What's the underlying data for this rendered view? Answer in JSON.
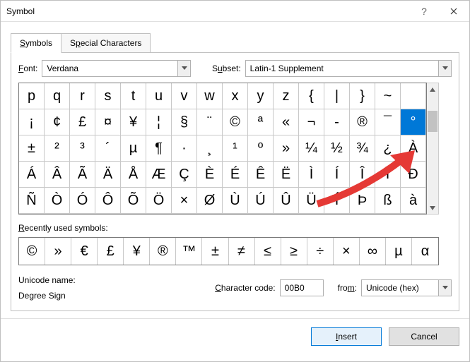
{
  "window": {
    "title": "Symbol"
  },
  "tabs": {
    "symbols": "Symbols",
    "special": "Special Characters"
  },
  "font": {
    "label": "Font:",
    "value": "Verdana"
  },
  "subset": {
    "label": "Subset:",
    "value": "Latin-1 Supplement"
  },
  "grid": [
    "p",
    "q",
    "r",
    "s",
    "t",
    "u",
    "v",
    "w",
    "x",
    "y",
    "z",
    "{",
    "|",
    "}",
    "~",
    "",
    "¡",
    "¢",
    "£",
    "¤",
    "¥",
    "¦",
    "§",
    "¨",
    "©",
    "ª",
    "«",
    "¬",
    "-",
    "®",
    "¯",
    "°",
    "±",
    "²",
    "³",
    "´",
    "µ",
    "¶",
    "·",
    "¸",
    "¹",
    "º",
    "»",
    "¼",
    "½",
    "¾",
    "¿",
    "À",
    "Á",
    "Â",
    "Ã",
    "Ä",
    "Å",
    "Æ",
    "Ç",
    "È",
    "É",
    "Ê",
    "Ë",
    "Ì",
    "Í",
    "Î",
    "Ï",
    "Ð",
    "Ñ",
    "Ò",
    "Ó",
    "Ô",
    "Õ",
    "Ö",
    "×",
    "Ø",
    "Ù",
    "Ú",
    "Û",
    "Ü",
    "Ý",
    "Þ",
    "ß",
    "à"
  ],
  "selected_index": 31,
  "recent": {
    "label": "Recently used symbols:",
    "items": [
      "©",
      "»",
      "€",
      "£",
      "¥",
      "®",
      "™",
      "±",
      "≠",
      "≤",
      "≥",
      "÷",
      "×",
      "∞",
      "µ",
      "α"
    ]
  },
  "unicode": {
    "name_label": "Unicode name:",
    "name": "Degree Sign"
  },
  "charcode": {
    "label": "Character code:",
    "value": "00B0"
  },
  "from": {
    "label": "from:",
    "value": "Unicode (hex)"
  },
  "buttons": {
    "insert": "Insert",
    "cancel": "Cancel"
  }
}
